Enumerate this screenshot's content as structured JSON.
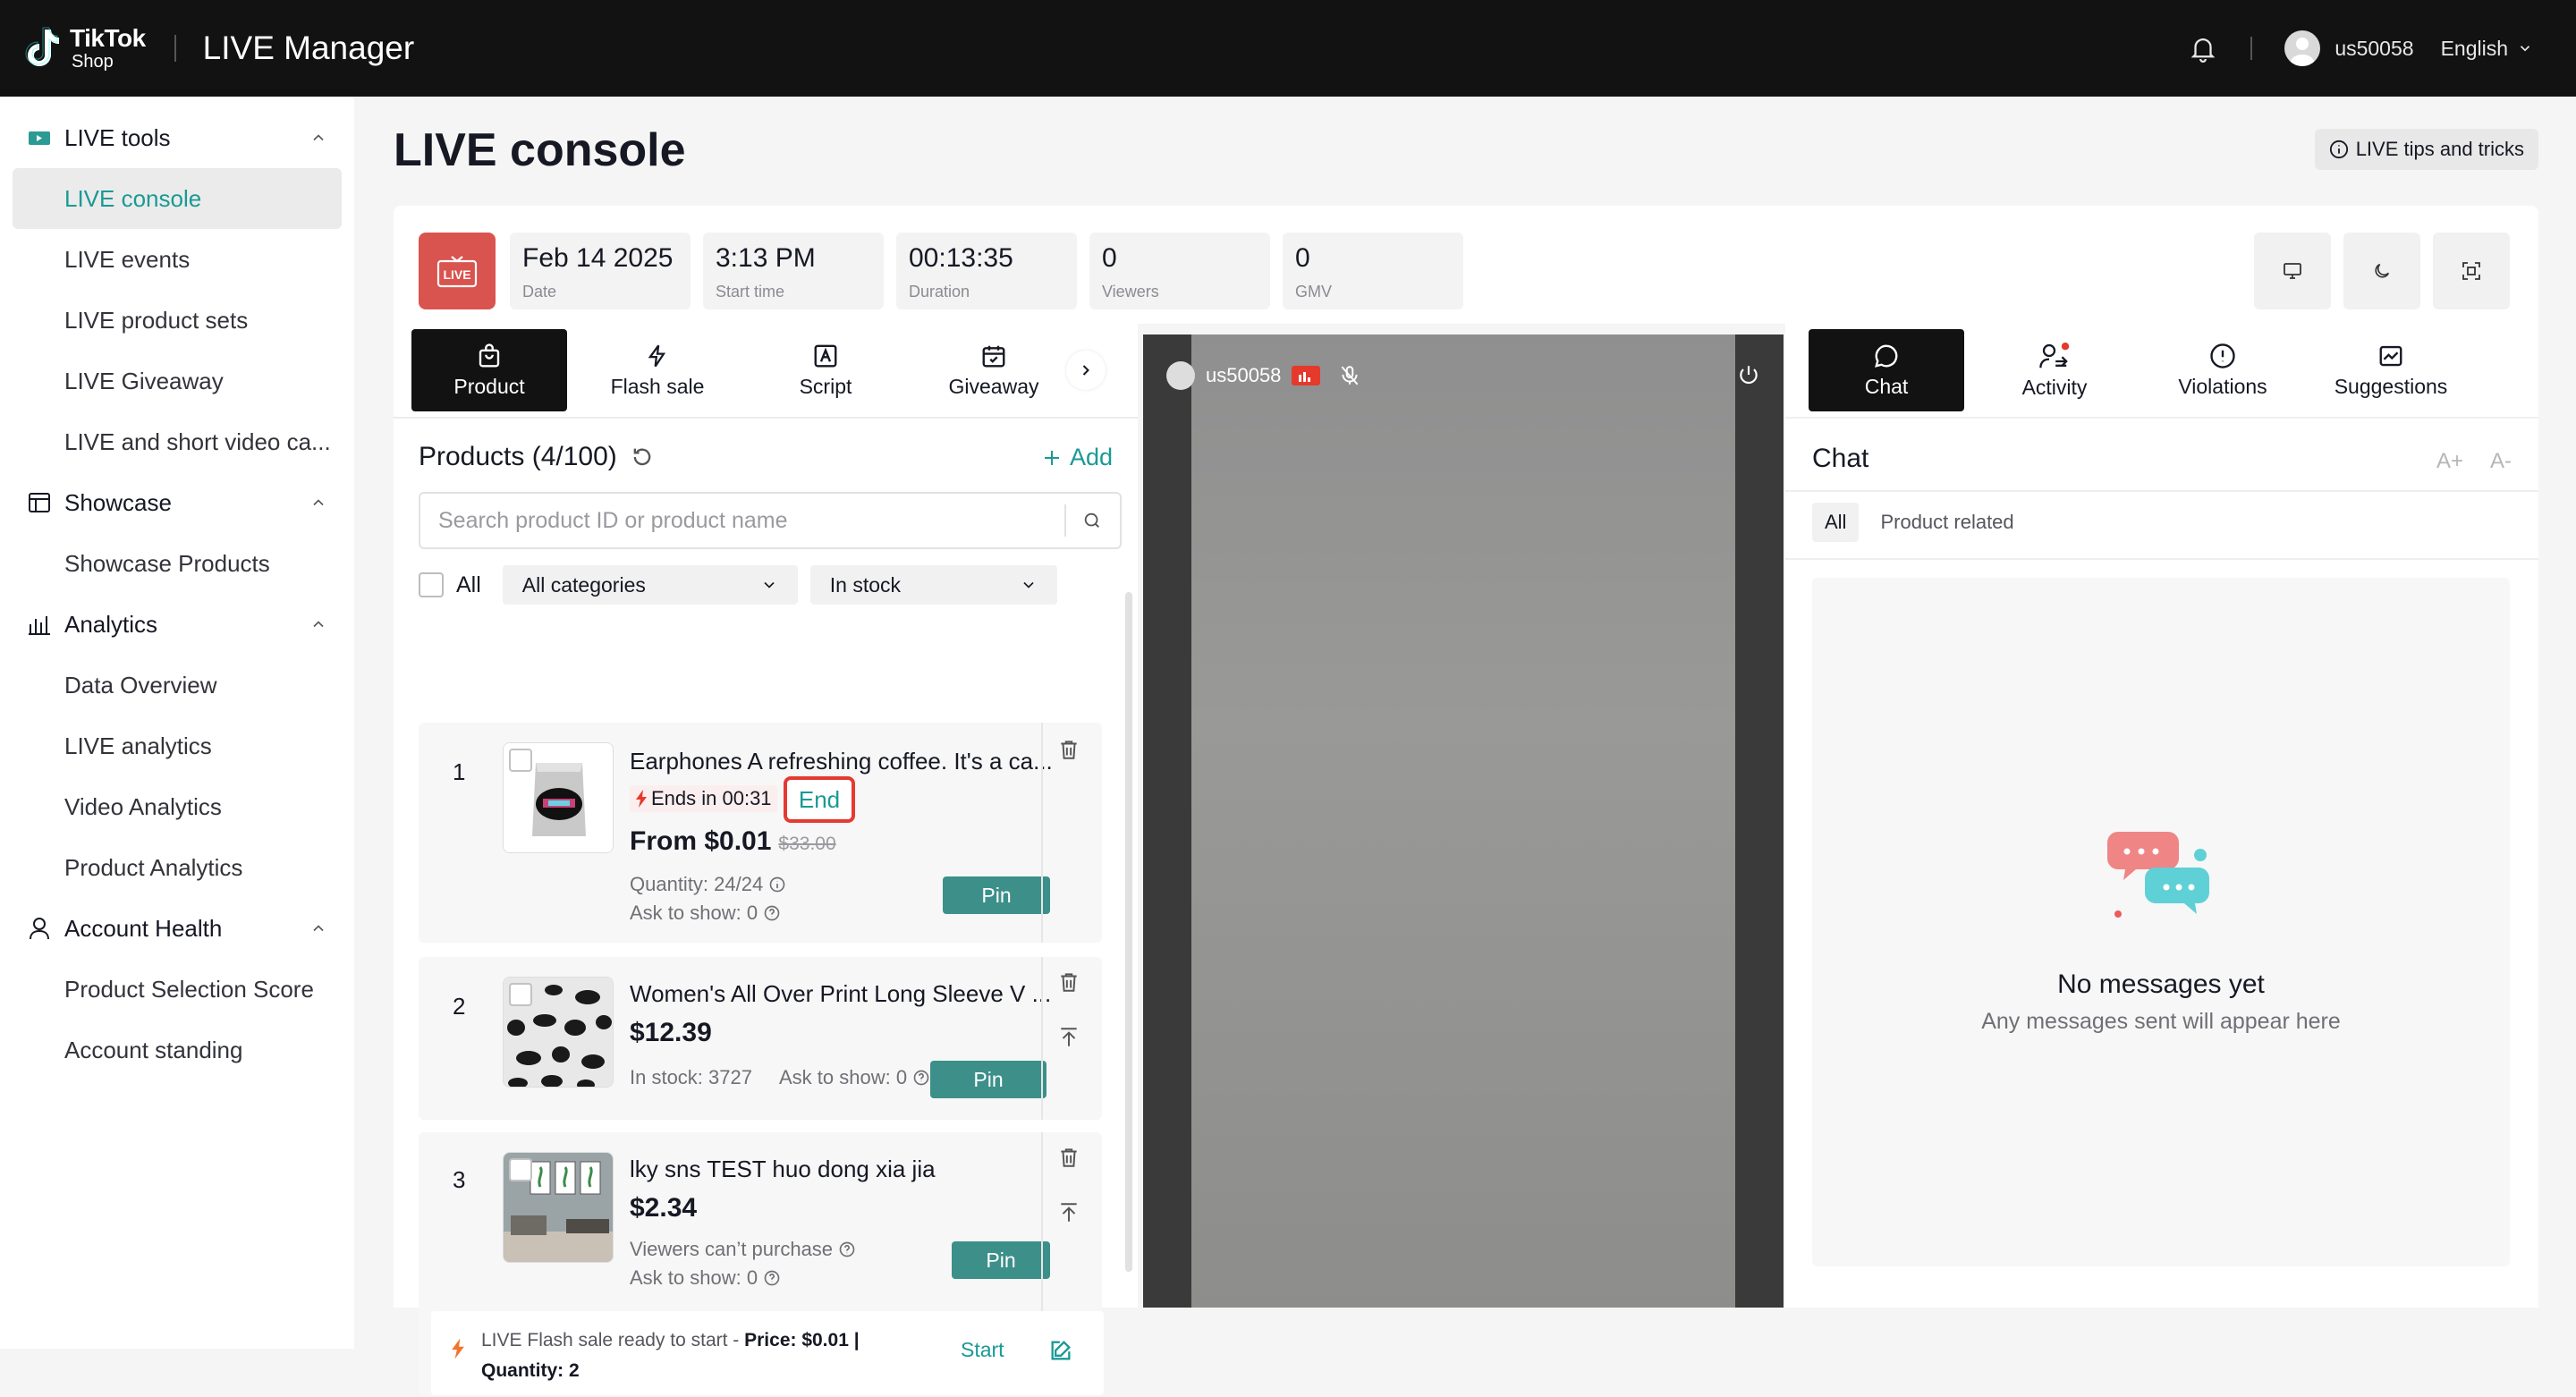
{
  "topbar": {
    "logo_line1": "TikTok",
    "logo_line2": "Shop",
    "app_title": "LIVE Manager",
    "username": "us50058",
    "language": "English"
  },
  "sidebar": {
    "groups": [
      {
        "label": "LIVE tools",
        "items": [
          "LIVE console",
          "LIVE events",
          "LIVE product sets",
          "LIVE Giveaway",
          "LIVE and short video ca..."
        ]
      },
      {
        "label": "Showcase",
        "items": [
          "Showcase Products"
        ]
      },
      {
        "label": "Analytics",
        "items": [
          "Data Overview",
          "LIVE analytics",
          "Video Analytics",
          "Product Analytics"
        ]
      },
      {
        "label": "Account Health",
        "items": [
          "Product Selection Score",
          "Account standing"
        ]
      }
    ],
    "active_item": "LIVE console",
    "accent": "#1a9a94"
  },
  "page": {
    "title": "LIVE console",
    "tips_button": "LIVE tips and tricks"
  },
  "stats": {
    "live_badge": "LIVE",
    "date": {
      "value": "Feb 14 2025",
      "label": "Date"
    },
    "start": {
      "value": "3:13 PM",
      "label": "Start time"
    },
    "duration": {
      "value": "00:13:35",
      "label": "Duration"
    },
    "viewers": {
      "value": "0",
      "label": "Viewers"
    },
    "gmv": {
      "value": "0",
      "label": "GMV"
    }
  },
  "left_tabs": [
    "Product",
    "Flash sale",
    "Script",
    "Giveaway"
  ],
  "products_panel": {
    "heading": "Products (4/100)",
    "add_label": "Add",
    "search_placeholder": "Search product ID or product name",
    "all_label": "All",
    "category_select": "All categories",
    "stock_select": "In stock"
  },
  "products": [
    {
      "num": "1",
      "title": "Earphones A refreshing coffee. It's a ca...",
      "flash_ends": "Ends in 00:31",
      "end_label": "End",
      "price": "From $0.01",
      "orig_price": "$33.00",
      "meta1": "Quantity: 24/24",
      "meta2": "Ask to show: 0",
      "pin": "Pin"
    },
    {
      "num": "2",
      "title": "Women's All Over Print Long Sleeve V ...",
      "price": "$12.39",
      "meta1": "In stock: 3727",
      "meta2": "Ask to show: 0",
      "pin": "Pin"
    },
    {
      "num": "3",
      "title": "lky sns    TEST huo dong xia jia",
      "price": "$2.34",
      "meta1": "Viewers can’t purchase",
      "meta2": "Ask to show: 0",
      "pin": "Pin"
    }
  ],
  "flash_bar": {
    "prefix": "LIVE Flash sale ready to start - ",
    "price": "Price: $0.01 |",
    "quantity": "Quantity: 2",
    "start": "Start"
  },
  "video": {
    "username": "us50058"
  },
  "right_tabs": [
    "Chat",
    "Activity",
    "Violations",
    "Suggestions"
  ],
  "chat": {
    "heading": "Chat",
    "font_up": "A+",
    "font_down": "A-",
    "filters": [
      "All",
      "Product related"
    ],
    "empty_title": "No messages yet",
    "empty_sub": "Any messages sent will appear here"
  }
}
